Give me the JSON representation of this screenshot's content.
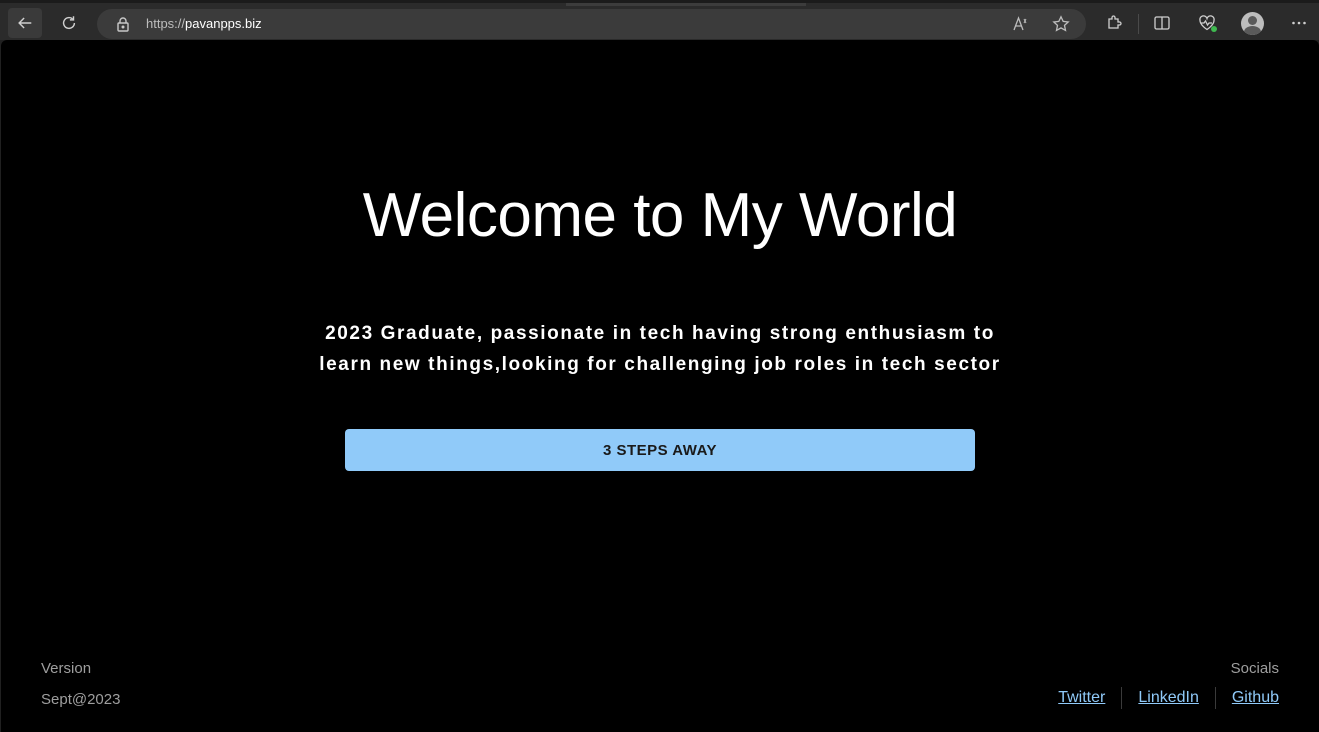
{
  "browser": {
    "url_scheme": "https://",
    "url_host": "pavanpps.biz",
    "icons": [
      "back-arrow-icon",
      "reload-icon",
      "lock-icon",
      "read-aloud-icon",
      "favorite-star-icon",
      "extensions-icon",
      "split-screen-icon",
      "browser-essentials-icon",
      "profile-avatar-icon",
      "more-options-icon"
    ]
  },
  "hero": {
    "title": "Welcome to My World",
    "line1": "2023 Graduate, passionate in tech having strong enthusiasm to",
    "line2": "learn new things,looking for challenging job roles in tech sector",
    "cta_label": "3 STEPS AWAY",
    "cta_color": "#90caf9"
  },
  "footer": {
    "version_label": "Version",
    "version_value": "Sept@2023",
    "socials_label": "Socials",
    "links": [
      {
        "label": "Twitter"
      },
      {
        "label": "LinkedIn"
      },
      {
        "label": "Github"
      }
    ],
    "link_color": "#90caf9"
  }
}
